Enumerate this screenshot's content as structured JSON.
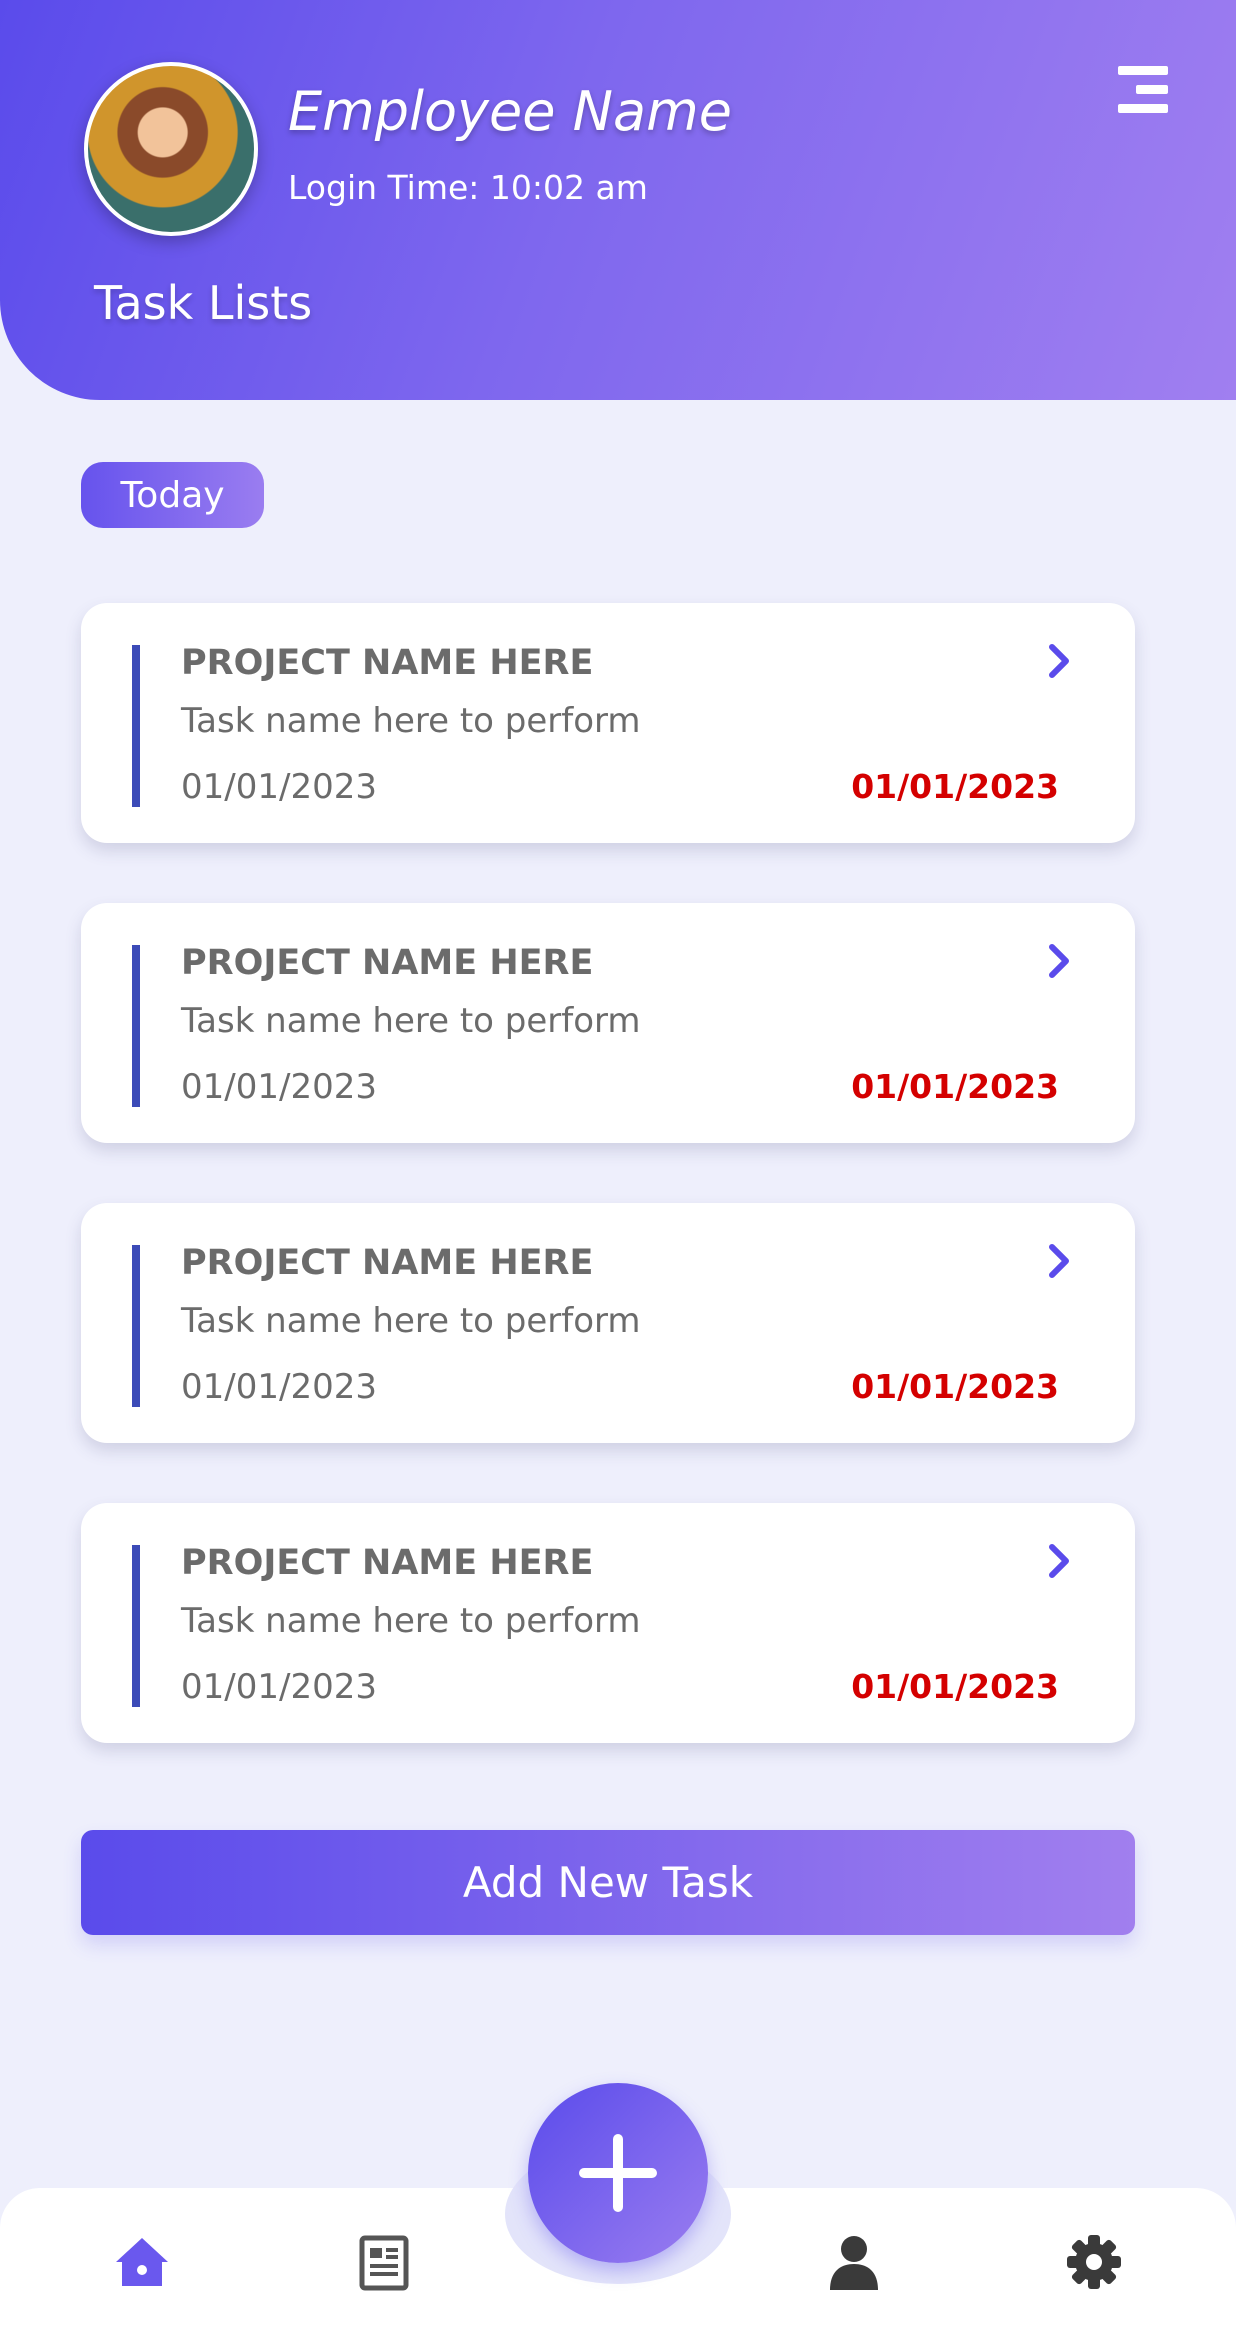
{
  "header": {
    "employee_name": "Employee Name",
    "login_time": "Login Time: 10:02 am",
    "section_title": "Task Lists"
  },
  "filter_chip": "Today",
  "tasks": [
    {
      "project": "PROJECT NAME HERE",
      "task": "Task name here to perform",
      "start_date": "01/01/2023",
      "due_date": "01/01/2023"
    },
    {
      "project": "PROJECT NAME HERE",
      "task": "Task name here to perform",
      "start_date": "01/01/2023",
      "due_date": "01/01/2023"
    },
    {
      "project": "PROJECT NAME HERE",
      "task": "Task name here to perform",
      "start_date": "01/01/2023",
      "due_date": "01/01/2023"
    },
    {
      "project": "PROJECT NAME HERE",
      "task": "Task name here to perform",
      "start_date": "01/01/2023",
      "due_date": "01/01/2023"
    }
  ],
  "add_button_label": "Add New Task",
  "nav": {
    "items": [
      "home-icon",
      "document-icon",
      "plus-icon",
      "user-icon",
      "settings-icon"
    ]
  },
  "colors": {
    "accent": "#5A4BEB",
    "accent_light": "#A07FF0",
    "background": "#EEEFFC",
    "due_date": "#D40000",
    "task_bar": "#3C4BB8"
  }
}
